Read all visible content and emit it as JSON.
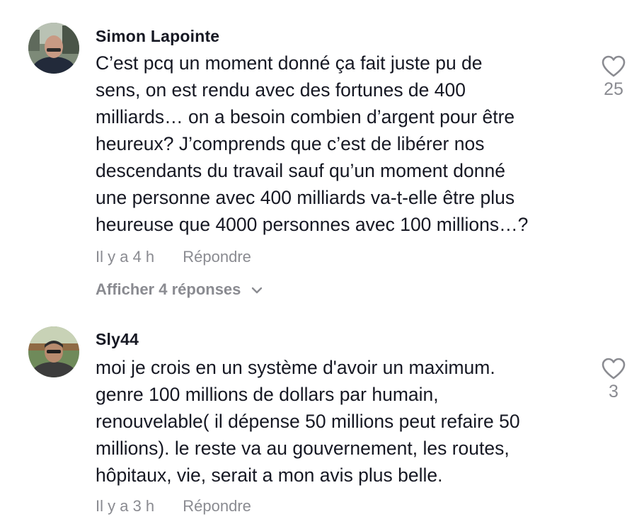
{
  "comments": [
    {
      "username": "Simon Lapointe",
      "avatar_icon": "user-avatar-photo",
      "lines": [
        "C’est pcq un moment donné ça fait juste pu de",
        "sens, on est rendu avec des fortunes de 400",
        "milliards… on a besoin combien d’argent pour être",
        "heureux? J’comprends que c’est de libérer nos",
        "descendants du travail sauf qu’un moment donné",
        "une personne avec 400 milliards va-t-elle être plus",
        "heureuse que 4000 personnes avec 100 millions…?"
      ],
      "time": "Il y a 4 h",
      "reply_label": "Répondre",
      "view_replies_label": "Afficher 4 réponses",
      "like_icon": "heart-outline-icon",
      "likes": "25"
    },
    {
      "username": "Sly44",
      "avatar_icon": "user-avatar-photo",
      "lines": [
        "moi je crois en un système d'avoir un maximum.",
        "genre 100 millions de dollars par humain,",
        "renouvelable( il dépense 50 millions peut refaire 50",
        "millions). le reste va au gouvernement, les routes,",
        "hôpitaux, vie, serait a mon avis plus belle."
      ],
      "time": "Il y a 3 h",
      "reply_label": "Répondre",
      "like_icon": "heart-outline-icon",
      "likes": "3"
    }
  ],
  "colors": {
    "text": "#161823",
    "muted": "#8a8b91",
    "background": "#ffffff"
  }
}
